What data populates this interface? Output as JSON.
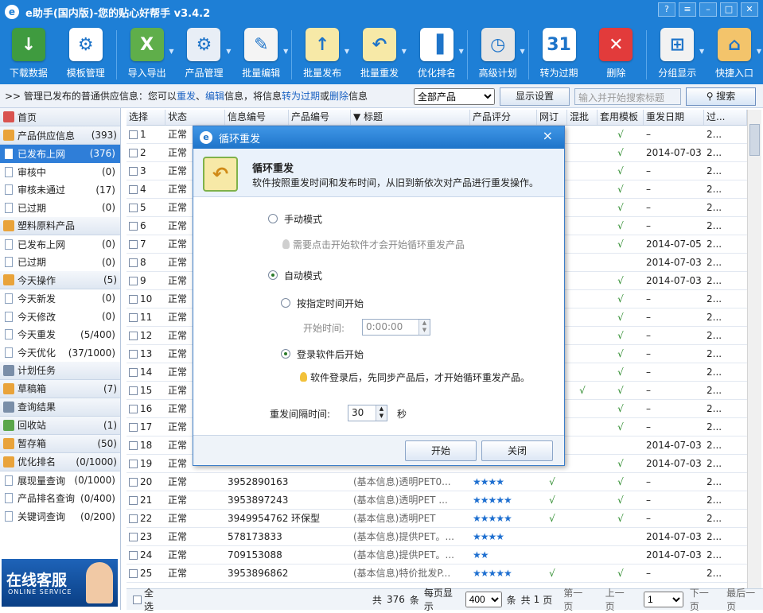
{
  "app": {
    "logo": "e",
    "title": "e助手(国内版)-您的贴心好帮手 v3.4.2",
    "help": "?",
    "menu": "≡",
    "min": "–",
    "max": "□",
    "close": "✕"
  },
  "toolbar": [
    {
      "label": "下载数据",
      "icon": "download-icon",
      "color": "#3f9b3f",
      "glyph": "↓"
    },
    {
      "label": "模板管理",
      "icon": "template-gear-icon",
      "color": "#ffffff",
      "glyph": "⚙"
    },
    {
      "label": "导入导出",
      "icon": "excel-import-icon",
      "color": "#5fae4a",
      "glyph": "X"
    },
    {
      "label": "产品管理",
      "icon": "product-gear-icon",
      "color": "#e8eef6",
      "glyph": "⚙"
    },
    {
      "label": "批量编辑",
      "icon": "edit-pencil-icon",
      "color": "#f4f4f4",
      "glyph": "✎"
    },
    {
      "label": "批量发布",
      "icon": "publish-upload-icon",
      "color": "#f7e9a7",
      "glyph": "↑"
    },
    {
      "label": "批量重发",
      "icon": "republish-icon",
      "color": "#f7e9a7",
      "glyph": "↶"
    },
    {
      "label": "优化排名",
      "icon": "rank-bar-icon",
      "color": "#ffffff",
      "glyph": "▐"
    },
    {
      "label": "高级计划",
      "icon": "clock-plan-icon",
      "color": "#e6e6e6",
      "glyph": "◷"
    },
    {
      "label": "转为过期",
      "icon": "calendar-icon",
      "color": "#ffffff",
      "glyph": "31"
    },
    {
      "label": "删除",
      "icon": "delete-icon",
      "color": "#e23b3b",
      "glyph": "✕"
    },
    {
      "label": "分组显示",
      "icon": "group-calc-icon",
      "color": "#f2f2f2",
      "glyph": "⊞"
    },
    {
      "label": "快捷入口",
      "icon": "home-icon",
      "color": "#f3c46b",
      "glyph": "⌂"
    }
  ],
  "actionbar": {
    "prefix": ">> 管理已发布的普通供应信息：您可以",
    "a1": "重发",
    "sep1": "、",
    "a2": "编辑",
    "t2": "信息，将信息",
    "a3": "转为过期",
    "t3": "或",
    "a4": "删除",
    "t4": "信息",
    "filter_value": "全部产品",
    "settings_label": "显示设置",
    "search_placeholder": "输入并开始搜索标题",
    "search_label": "搜索"
  },
  "sidebar": {
    "home": "首页",
    "g1": {
      "label": "产品供应信息",
      "count": "(393)"
    },
    "g1_items": [
      {
        "label": "已发布上网",
        "count": "(376)"
      },
      {
        "label": "审核中",
        "count": "(0)"
      },
      {
        "label": "审核未通过",
        "count": "(17)"
      },
      {
        "label": "已过期",
        "count": "(0)"
      }
    ],
    "g2": {
      "label": "塑料原料产品",
      "count": ""
    },
    "g2_items": [
      {
        "label": "已发布上网",
        "count": "(0)"
      },
      {
        "label": "已过期",
        "count": "(0)"
      }
    ],
    "g3": {
      "label": "今天操作",
      "count": "(5)"
    },
    "g3_items": [
      {
        "label": "今天新发",
        "count": "(0)"
      },
      {
        "label": "今天修改",
        "count": "(0)"
      },
      {
        "label": "今天重发",
        "count": "(5/400)"
      },
      {
        "label": "今天优化",
        "count": "(37/1000)"
      }
    ],
    "g4": {
      "label": "计划任务",
      "count": ""
    },
    "g5": {
      "label": "草稿箱",
      "count": "(7)"
    },
    "g6": {
      "label": "查询结果",
      "count": ""
    },
    "g7": {
      "label": "回收站",
      "count": "(1)"
    },
    "g8": {
      "label": "暂存箱",
      "count": "(50)"
    },
    "g9": {
      "label": "优化排名",
      "count": "(0/1000)"
    },
    "g9_items": [
      {
        "label": "展现量查询",
        "count": "(0/1000)"
      },
      {
        "label": "产品排名查询",
        "count": "(0/400)"
      },
      {
        "label": "关键词查询",
        "count": "(0/200)"
      }
    ],
    "service_cn": "在线客服",
    "service_en": "ONLINE SERVICE"
  },
  "table": {
    "headers": [
      "选择",
      "状态",
      "信息编号",
      "产品编号",
      "▼ 标题",
      "产品评分",
      "网订",
      "混批",
      "套用模板",
      "重发日期",
      "过..."
    ],
    "rows": [
      [
        "1",
        "正常",
        "",
        "",
        "",
        "",
        "",
        "",
        "√",
        "–",
        "2..."
      ],
      [
        "2",
        "正常",
        "",
        "",
        "",
        "",
        "",
        "",
        "√",
        "2014-07-03",
        "2..."
      ],
      [
        "3",
        "正常",
        "",
        "",
        "",
        "",
        "",
        "",
        "√",
        "–",
        "2..."
      ],
      [
        "4",
        "正常",
        "",
        "",
        "",
        "",
        "",
        "",
        "√",
        "–",
        "2..."
      ],
      [
        "5",
        "正常",
        "",
        "",
        "",
        "",
        "",
        "",
        "√",
        "–",
        "2..."
      ],
      [
        "6",
        "正常",
        "",
        "",
        "",
        "",
        "",
        "",
        "√",
        "–",
        "2..."
      ],
      [
        "7",
        "正常",
        "",
        "",
        "",
        "",
        "",
        "",
        "√",
        "2014-07-05",
        "2..."
      ],
      [
        "8",
        "正常",
        "",
        "",
        "",
        "",
        "",
        "",
        "",
        "2014-07-03",
        "2..."
      ],
      [
        "9",
        "正常",
        "",
        "",
        "",
        "",
        "",
        "",
        "√",
        "2014-07-03",
        "2..."
      ],
      [
        "10",
        "正常",
        "",
        "",
        "",
        "",
        "",
        "",
        "√",
        "–",
        "2..."
      ],
      [
        "11",
        "正常",
        "",
        "",
        "",
        "",
        "",
        "",
        "√",
        "–",
        "2..."
      ],
      [
        "12",
        "正常",
        "",
        "",
        "",
        "",
        "",
        "",
        "√",
        "–",
        "2..."
      ],
      [
        "13",
        "正常",
        "",
        "",
        "",
        "",
        "",
        "",
        "√",
        "–",
        "2..."
      ],
      [
        "14",
        "正常",
        "",
        "",
        "",
        "",
        "",
        "",
        "√",
        "–",
        "2..."
      ],
      [
        "15",
        "正常",
        "",
        "",
        "",
        "",
        "",
        "√",
        "√",
        "–",
        "2..."
      ],
      [
        "16",
        "正常",
        "",
        "",
        "",
        "",
        "",
        "",
        "√",
        "–",
        "2..."
      ],
      [
        "17",
        "正常",
        "",
        "",
        "",
        "",
        "",
        "",
        "√",
        "–",
        "2..."
      ],
      [
        "18",
        "正常",
        "",
        "",
        "",
        "",
        "",
        "",
        "",
        "2014-07-03",
        "2..."
      ],
      [
        "19",
        "正常",
        "",
        "",
        "",
        "",
        "",
        "",
        "√",
        "2014-07-03",
        "2..."
      ],
      [
        "20",
        "正常",
        "39528901632",
        "",
        "(基本信息)透明PET0...",
        "★★★★",
        "√",
        "",
        "√",
        "–",
        "2..."
      ],
      [
        "21",
        "正常",
        "39538972436",
        "",
        "(基本信息)透明PET ...",
        "★★★★★",
        "√",
        "",
        "√",
        "–",
        "2..."
      ],
      [
        "22",
        "正常",
        "39499547623",
        "环保型",
        "(基本信息)透明PET",
        "★★★★★",
        "√",
        "",
        "√",
        "–",
        "2..."
      ],
      [
        "23",
        "正常",
        "578173833",
        "",
        "(基本信息)提供PET。...",
        "★★★★",
        "",
        "",
        "",
        "2014-07-03",
        "2..."
      ],
      [
        "24",
        "正常",
        "709153088",
        "",
        "(基本信息)提供PET。...",
        "★★",
        "",
        "",
        "",
        "2014-07-03",
        "2..."
      ],
      [
        "25",
        "正常",
        "39538968620",
        "",
        "(基本信息)特价批发P...",
        "★★★★★",
        "√",
        "",
        "√",
        "–",
        "2..."
      ]
    ]
  },
  "footer": {
    "select_all": "全选",
    "total_prefix": "共",
    "total": "376",
    "total_unit": "条",
    "per_page_label": "每页显示",
    "per_page": "400",
    "per_page_unit": "条",
    "pages_prefix": "共",
    "pages": "1",
    "pages_unit": "页",
    "first": "第一页",
    "prev": "上一页",
    "page": "1",
    "next": "下一页",
    "last": "最后一页"
  },
  "dialog": {
    "title": "循环重发",
    "close": "×",
    "heading": "循环重发",
    "desc": "软件按照重发时间和发布时间，从旧到新依次对产品进行重发操作。",
    "manual_label": "手动模式",
    "manual_hint": "需要点击开始软件才会开始循环重发产品",
    "auto_label": "自动模式",
    "opt_time_label": "按指定时间开始",
    "start_time_label": "开始时间:",
    "start_time_value": "0:00:00",
    "opt_login_label": "登录软件后开始",
    "login_hint": "软件登录后，先同步产品后，才开始循环重发产品。",
    "interval_label": "重发间隔时间:",
    "interval_value": "30",
    "interval_unit": "秒",
    "start_btn": "开始",
    "close_btn": "关闭"
  },
  "colors": {
    "titlebar": "#1e7fd6",
    "selected": "#2f7ed8",
    "stars": "#1e6fd0",
    "tick": "#2a8a2a",
    "hint_bulb": "#f2c13a"
  }
}
